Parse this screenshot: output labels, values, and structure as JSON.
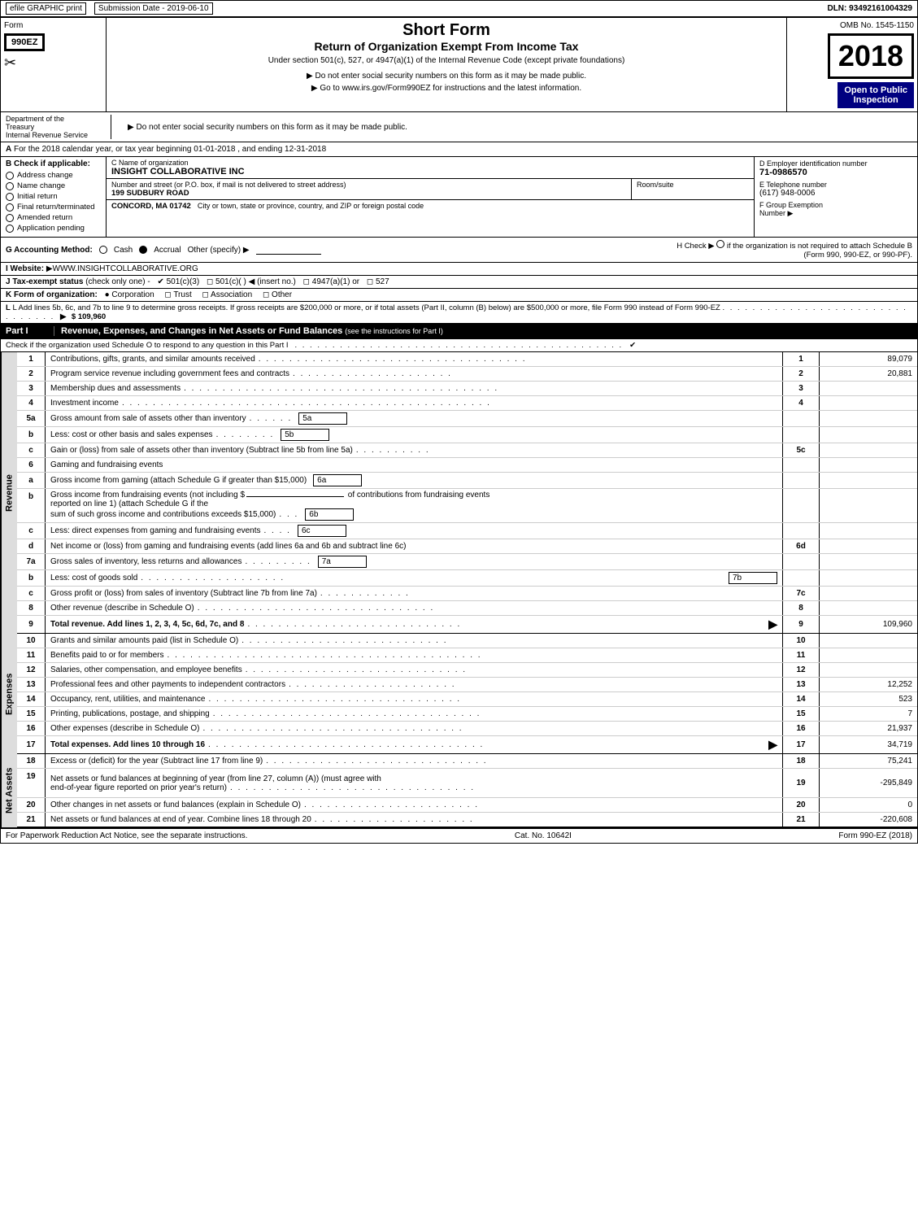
{
  "topBar": {
    "efile": "efile GRAPHIC print",
    "submission": "Submission Date - 2019-06-10",
    "dln": "DLN: 93492161004329"
  },
  "header": {
    "formLabel": "Form",
    "formNumber": "990EZ",
    "title1": "Short Form",
    "title2": "Return of Organization Exempt From Income Tax",
    "subtitle": "Under section 501(c), 527, or 4947(a)(1) of the Internal Revenue Code (except private foundations)",
    "notice1": "▶ Do not enter social security numbers on this form as it may be made public.",
    "notice2": "▶ Go to www.irs.gov/Form990EZ for instructions and the latest information.",
    "ombNo": "OMB No. 1545-1150",
    "year": "2018",
    "openLabel": "Open to Public",
    "inspectionLabel": "Inspection"
  },
  "dept": {
    "line1": "Department of the",
    "line2": "Treasury",
    "line3": "Internal Revenue Service"
  },
  "sectionA": {
    "label": "A",
    "text": "For the 2018 calendar year, or tax year beginning 01-01-2018",
    "ending": ", and ending 12-31-2018"
  },
  "sectionB": {
    "label": "B",
    "text": "Check if applicable:"
  },
  "checkItems": [
    {
      "label": "Address change",
      "checked": false
    },
    {
      "label": "Name change",
      "checked": false
    },
    {
      "label": "Initial return",
      "checked": false
    },
    {
      "label": "Final return/terminated",
      "checked": false
    },
    {
      "label": "Amended return",
      "checked": false
    },
    {
      "label": "Application pending",
      "checked": false
    }
  ],
  "orgInfo": {
    "nameLabel": "C Name of organization",
    "nameValue": "INSIGHT COLLABORATIVE INC",
    "addrLabel": "Number and street (or P.O. box, if mail is not delivered to street address)",
    "addrValue": "199 SUDBURY ROAD",
    "roomLabel": "Room/suite",
    "cityLine": "CONCORD, MA  01742",
    "cityLabel": "City or town, state or province, country, and ZIP or foreign postal code"
  },
  "einInfo": {
    "dLabel": "D Employer identification number",
    "dValue": "71-0986570",
    "eLabel": "E Telephone number",
    "eValue": "(617) 948-0006",
    "fLabel": "F Group Exemption",
    "fLabel2": "Number",
    "arrowRight": "▶"
  },
  "accounting": {
    "gLabel": "G Accounting Method:",
    "cash": "Cash",
    "accrual": "Accrual",
    "other": "Other (specify) ▶",
    "checkH": "H  Check ▶",
    "checkHText": "if the organization is not required to attach Schedule B (Form 990, 990-EZ, or 990-PF)."
  },
  "website": {
    "iLabel": "I Website:",
    "iValue": "▶WWW.INSIGHTCOLLABORATIVE.ORG"
  },
  "taxExempt": {
    "jLabel": "J Tax-exempt status",
    "jNote": "(check only one) -",
    "j501c3": "✔ 501(c)(3)",
    "j501c": "◻ 501(c)(",
    "jInsert": "  ) ◀ (insert no.)",
    "j4947": "◻ 4947(a)(1) or",
    "j527": "◻ 527"
  },
  "formOrg": {
    "kLabel": "K Form of organization:",
    "corp": "● Corporation",
    "trust": "◻ Trust",
    "assoc": "◻ Association",
    "other": "◻ Other"
  },
  "lineL": {
    "text": "L Add lines 5b, 6c, and 7b to line 9 to determine gross receipts. If gross receipts are $200,000 or more, or if total assets (Part II, column (B) below) are $500,000 or more, file Form 990 instead of Form 990-EZ",
    "dots": ". . . . . . . . . . . . . . . . . . . . . . . . . . . . . . . . .",
    "arrow": "▶",
    "amount": "$ 109,960"
  },
  "partI": {
    "label": "Part I",
    "title": "Revenue, Expenses, and Changes in Net Assets or Fund Balances",
    "titleNote": "(see the instructions for Part I)",
    "checkNote": "Check if the organization used Schedule O to respond to any question in this Part I",
    "checkMark": "✔"
  },
  "revenueRows": [
    {
      "num": "1",
      "desc": "Contributions, gifts, grants, and similar amounts received",
      "dots": true,
      "lineNum": "1",
      "amount": "89,079"
    },
    {
      "num": "2",
      "desc": "Program service revenue including government fees and contracts",
      "dots": true,
      "lineNum": "2",
      "amount": "20,881"
    },
    {
      "num": "3",
      "desc": "Membership dues and assessments",
      "dots": true,
      "lineNum": "3",
      "amount": ""
    },
    {
      "num": "4",
      "desc": "Investment income",
      "dots": true,
      "lineNum": "4",
      "amount": ""
    },
    {
      "num": "5a",
      "desc": "Gross amount from sale of assets other than inventory",
      "subLabel": "5a",
      "subAmt": "",
      "lineNum": "",
      "amount": ""
    },
    {
      "num": "5b",
      "desc": "Less: cost or other basis and sales expenses",
      "subLabel": "5b",
      "subAmt": "",
      "lineNum": "",
      "amount": ""
    },
    {
      "num": "5c",
      "desc": "Gain or (loss) from sale of assets other than inventory (Subtract line 5b from line 5a)",
      "dots": true,
      "lineNum": "5c",
      "amount": ""
    },
    {
      "num": "6",
      "desc": "Gaming and fundraising events",
      "lineNum": "",
      "amount": ""
    }
  ],
  "gamingRows": [
    {
      "num": "a",
      "desc": "Gross income from gaming (attach Schedule G if greater than $15,000)",
      "subLabel": "6a",
      "subAmt": ""
    },
    {
      "num": "b",
      "desc1": "Gross income from fundraising events (not including $",
      "desc2": "of contributions from fundraising events reported on line 1) (attach Schedule G if the",
      "desc3": "sum of such gross income and contributions exceeds $15,000)",
      "subLabel": "6b",
      "subAmt": ""
    },
    {
      "num": "c",
      "desc": "Less: direct expenses from gaming and fundraising events",
      "subLabel": "6c",
      "subAmt": ""
    },
    {
      "num": "d",
      "desc": "Net income or (loss) from gaming and fundraising events (add lines 6a and 6b and subtract line 6c)",
      "lineNum": "6d",
      "amount": ""
    }
  ],
  "inventoryRows": [
    {
      "num": "7a",
      "desc": "Gross sales of inventory, less returns and allowances",
      "dots": true,
      "subLabel": "7a",
      "subAmt": ""
    },
    {
      "num": "7b",
      "desc": "Less: cost of goods sold",
      "dots": true,
      "subLabel": "7b",
      "subAmt": ""
    },
    {
      "num": "7c",
      "desc": "Gross profit or (loss) from sales of inventory (Subtract line 7b from line 7a)",
      "dots": true,
      "lineNum": "7c",
      "amount": ""
    }
  ],
  "otherRevenueRows": [
    {
      "num": "8",
      "desc": "Other revenue (describe in Schedule O)",
      "dots": true,
      "lineNum": "8",
      "amount": ""
    },
    {
      "num": "9",
      "desc": "Total revenue. Add lines 1, 2, 3, 4, 5c, 6d, 7c, and 8",
      "dots": true,
      "arrow": true,
      "lineNum": "9",
      "amount": "109,960",
      "bold": true
    }
  ],
  "expenseRows": [
    {
      "num": "10",
      "desc": "Grants and similar amounts paid (list in Schedule O)",
      "dots": true,
      "lineNum": "10",
      "amount": ""
    },
    {
      "num": "11",
      "desc": "Benefits paid to or for members",
      "dots": true,
      "lineNum": "11",
      "amount": ""
    },
    {
      "num": "12",
      "desc": "Salaries, other compensation, and employee benefits",
      "dots": true,
      "lineNum": "12",
      "amount": ""
    },
    {
      "num": "13",
      "desc": "Professional fees and other payments to independent contractors",
      "dots": true,
      "lineNum": "13",
      "amount": "12,252"
    },
    {
      "num": "14",
      "desc": "Occupancy, rent, utilities, and maintenance",
      "dots": true,
      "lineNum": "14",
      "amount": "523"
    },
    {
      "num": "15",
      "desc": "Printing, publications, postage, and shipping",
      "dots": true,
      "lineNum": "15",
      "amount": "7"
    },
    {
      "num": "16",
      "desc": "Other expenses (describe in Schedule O)",
      "dots": true,
      "lineNum": "16",
      "amount": "21,937"
    },
    {
      "num": "17",
      "desc": "Total expenses. Add lines 10 through 16",
      "dots": true,
      "arrow": true,
      "lineNum": "17",
      "amount": "34,719",
      "bold": true
    }
  ],
  "netAssetRows": [
    {
      "num": "18",
      "desc": "Excess or (deficit) for the year (Subtract line 17 from line 9)",
      "dots": true,
      "lineNum": "18",
      "amount": "75,241"
    },
    {
      "num": "19",
      "desc": "Net assets or fund balances at beginning of year (from line 27, column (A)) (must agree with end-of-year figure reported on prior year's return)",
      "dots": true,
      "lineNum": "19",
      "amount": "-295,849"
    },
    {
      "num": "20",
      "desc": "Other changes in net assets or fund balances (explain in Schedule O)",
      "dots": true,
      "lineNum": "20",
      "amount": "0"
    },
    {
      "num": "21",
      "desc": "Net assets or fund balances at end of year. Combine lines 18 through 20",
      "dots": true,
      "lineNum": "21",
      "amount": "-220,608"
    }
  ],
  "footer": {
    "paperwork": "For Paperwork Reduction Act Notice, see the separate instructions.",
    "catNo": "Cat. No. 10642I",
    "formRef": "Form 990-EZ (2018)"
  }
}
